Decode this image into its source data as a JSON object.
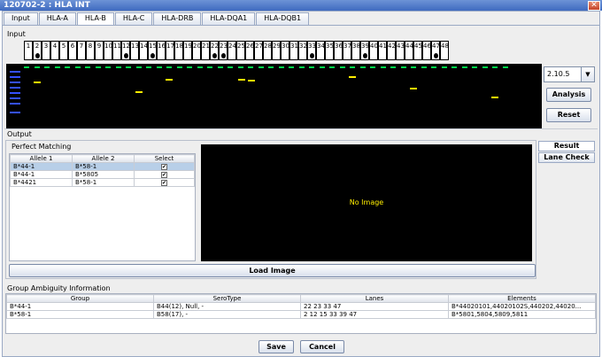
{
  "window": {
    "title": "120702-2 : HLA INT"
  },
  "tabs": [
    "Input",
    "HLA-A",
    "HLA-B",
    "HLA-C",
    "HLA-DRB",
    "HLA-DQA1",
    "HLA-DQB1"
  ],
  "active_tab": "HLA-B",
  "input": {
    "label": "Input",
    "lanes": [
      "1",
      "2",
      "3",
      "4",
      "5",
      "6",
      "7",
      "8",
      "9",
      "10",
      "11",
      "12",
      "13",
      "14",
      "15",
      "16",
      "17",
      "18",
      "19",
      "20",
      "21",
      "22",
      "23",
      "24",
      "25",
      "26",
      "27",
      "28",
      "29",
      "30",
      "31",
      "32",
      "33",
      "34",
      "35",
      "36",
      "37",
      "38",
      "39",
      "40",
      "41",
      "42",
      "43",
      "44",
      "45",
      "46",
      "47",
      "48"
    ],
    "marked_lanes": [
      2,
      12,
      15,
      22,
      23,
      33,
      39,
      47
    ],
    "version_select": "2.10.5",
    "analysis_label": "Analysis",
    "reset_label": "Reset"
  },
  "output": {
    "label": "Output",
    "perfect_matching_label": "Perfect Matching",
    "columns": [
      "Allele 1",
      "Allele 2",
      "Select"
    ],
    "rows": [
      {
        "allele1": "B*44-1",
        "allele2": "B*58-1",
        "selected": true
      },
      {
        "allele1": "B*44-1",
        "allele2": "B*5805",
        "selected": true
      },
      {
        "allele1": "B*4421",
        "allele2": "B*58-1",
        "selected": true
      }
    ],
    "no_image_label": "No Image",
    "load_image_label": "Load Image",
    "result_tab": "Result",
    "lane_check_tab": "Lane Check"
  },
  "ambiguity": {
    "label": "Group Ambiguity Information",
    "columns": [
      "Group",
      "SeroType",
      "Lanes",
      "Elements"
    ],
    "rows": [
      {
        "group": "B*44-1",
        "serotype": "B44(12), Null, -",
        "lanes": "22 23 33 47",
        "elements": "B*44020101,44020102S,440202,44020..."
      },
      {
        "group": "B*58-1",
        "serotype": "B58(17), -",
        "lanes": "2 12 15 33 39 47",
        "elements": "B*5801,5804,5809,5811"
      }
    ]
  },
  "footer": {
    "save_label": "Save",
    "cancel_label": "Cancel"
  }
}
